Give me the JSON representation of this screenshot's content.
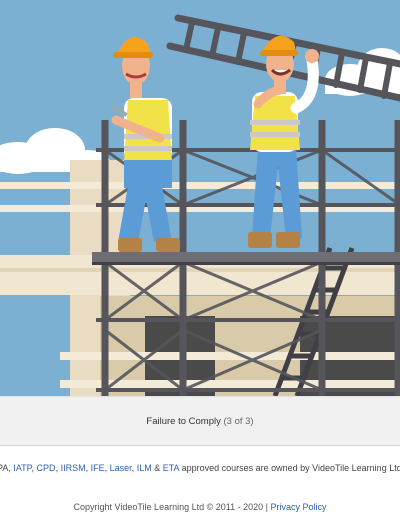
{
  "caption": {
    "title": "Failure to Comply",
    "count": "(3 of 3)"
  },
  "accreditation": {
    "prefix": "PA, ",
    "bodies": [
      "IATP",
      "CPD",
      "IIRSM",
      "IFE",
      "Laser",
      "ILM"
    ],
    "sep": ", ",
    "amp": " & ",
    "last": "ETA",
    "suffix": " approved courses are owned by VideoTile Learning Ltd a"
  },
  "footer": {
    "copyright": "Copyright VideoTile Learning Ltd © 2011 - 2020 | ",
    "privacy": "Privacy Policy"
  },
  "colors": {
    "sky": "#7bb0d2",
    "scaffold": "#55555b",
    "hardhat": "#f7a21b",
    "vest": "#f2e24a",
    "jeans": "#5b9bd6",
    "link": "#2f5fb3"
  }
}
